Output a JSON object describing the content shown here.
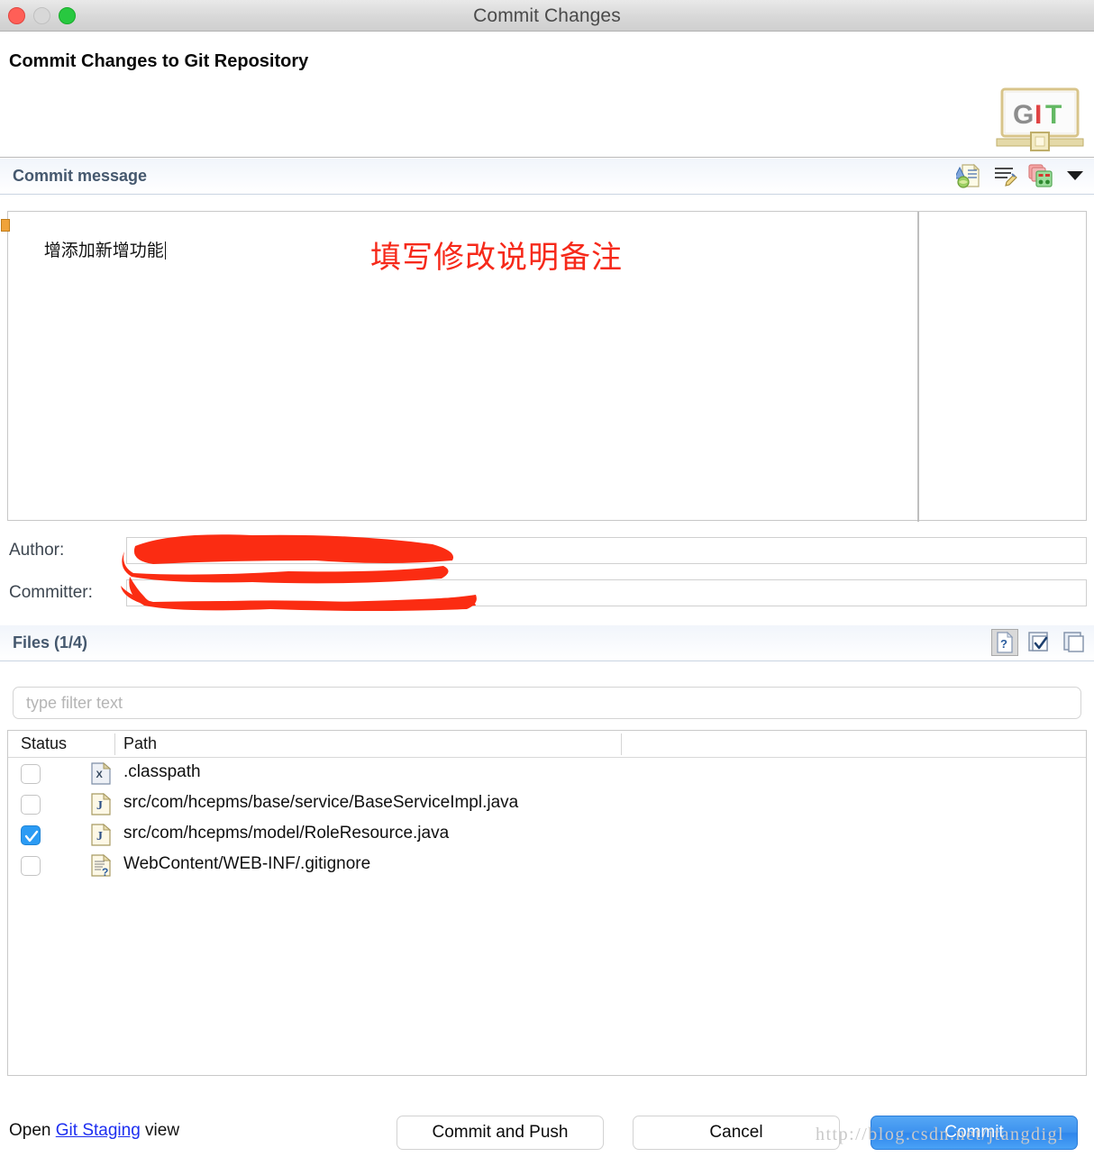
{
  "window": {
    "title": "Commit Changes",
    "traffic_lights": [
      "close-button",
      "minimize-button",
      "zoom-button"
    ]
  },
  "header": {
    "title": "Commit Changes to Git Repository",
    "logo": {
      "name": "git-logo",
      "letters": [
        "G",
        "I",
        "T"
      ]
    }
  },
  "commit_message_section": {
    "label": "Commit message",
    "value": "增添加新增功能",
    "toolbar": [
      {
        "name": "add-signed-off-by-icon",
        "tooltip": "Add Signed-off-by"
      },
      {
        "name": "add-change-id-icon",
        "tooltip": "Add Change-Id"
      },
      {
        "name": "amend-previous-commit-icon",
        "tooltip": "Amend previous commit"
      },
      {
        "name": "chevron-down-icon",
        "tooltip": "View Menu"
      }
    ]
  },
  "annotation": {
    "text": "填写修改说明备注",
    "color": "#f6291a"
  },
  "fields": [
    {
      "name": "author",
      "label": "Author:",
      "value": "",
      "redacted": true
    },
    {
      "name": "committer",
      "label": "Committer:",
      "value": "",
      "redacted": true
    }
  ],
  "files_section": {
    "label": "Files (1/4)",
    "selected_count": 1,
    "total_count": 4,
    "toolbar": [
      {
        "name": "show-untracked-files-icon",
        "pressed": true
      },
      {
        "name": "select-all-icon",
        "pressed": false
      },
      {
        "name": "deselect-all-icon",
        "pressed": false
      }
    ],
    "filter": {
      "placeholder": "type filter text",
      "value": ""
    },
    "columns": [
      "Status",
      "Path"
    ],
    "rows": [
      {
        "checked": false,
        "icon": "xml-file-icon",
        "path": ".classpath"
      },
      {
        "checked": false,
        "icon": "java-file-icon",
        "path": "src/com/hcepms/base/service/BaseServiceImpl.java"
      },
      {
        "checked": true,
        "icon": "java-file-icon",
        "path": "src/com/hcepms/model/RoleResource.java"
      },
      {
        "checked": false,
        "icon": "untracked-file-icon",
        "path": "WebContent/WEB-INF/.gitignore"
      }
    ]
  },
  "footer": {
    "open_prefix": "Open ",
    "open_link": "Git Staging",
    "open_suffix": " view",
    "buttons": [
      {
        "name": "commit-and-push-button",
        "label": "Commit and Push",
        "primary": false
      },
      {
        "name": "cancel-button",
        "label": "Cancel",
        "primary": false
      },
      {
        "name": "commit-button",
        "label": "Commit",
        "primary": true
      }
    ]
  },
  "watermark": {
    "text": "http://blog.csdn.net/jtangdigl"
  },
  "colors": {
    "accent_blue": "#2b9bf4",
    "annotation_red": "#f6291a",
    "redaction_red": "#fb2c12",
    "link_blue": "#1d2ef0",
    "section_text": "#45586e"
  }
}
